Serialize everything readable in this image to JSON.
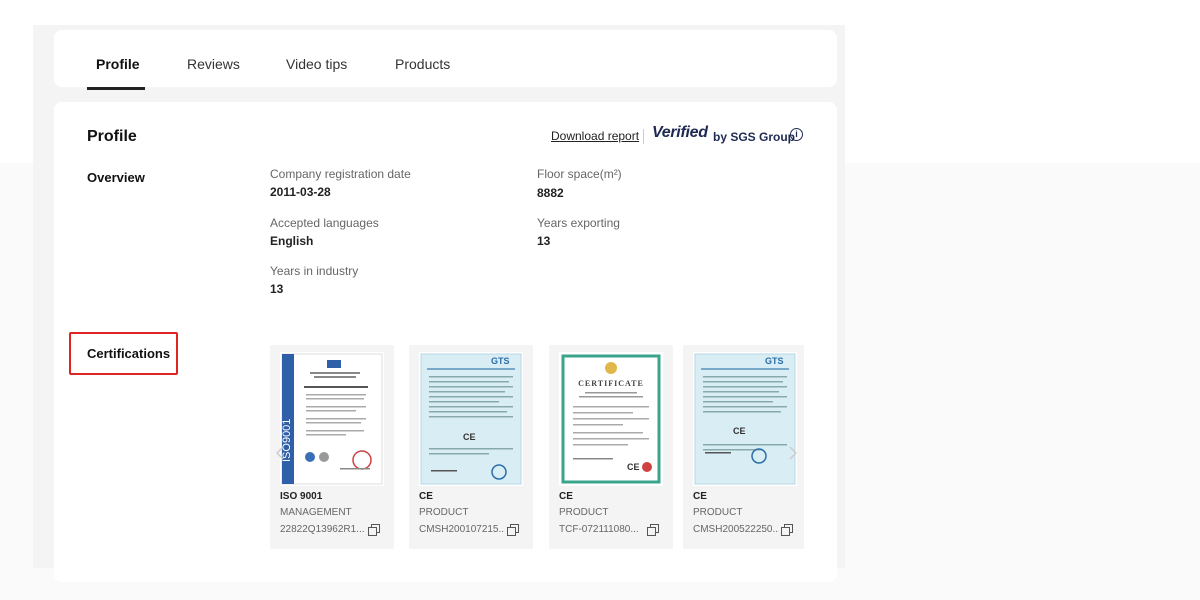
{
  "tabs": [
    {
      "label": "Profile"
    },
    {
      "label": "Reviews"
    },
    {
      "label": "Video tips"
    },
    {
      "label": "Products"
    }
  ],
  "profile": {
    "title": "Profile",
    "download_report": "Download report",
    "verified_word": "Verified",
    "verified_by": "by SGS Group",
    "info_icon": "info-icon"
  },
  "overview": {
    "label": "Overview",
    "fields": [
      {
        "label": "Company registration date",
        "value": "2011-03-28"
      },
      {
        "label": "Floor space(m²)",
        "value": "8882"
      },
      {
        "label": "Accepted languages",
        "value": "English"
      },
      {
        "label": "Years exporting",
        "value": "13"
      },
      {
        "label": "Years in industry",
        "value": "13"
      }
    ]
  },
  "certifications": {
    "label": "Certifications",
    "highlight_color": "#e02424",
    "items": [
      {
        "name": "ISO 9001",
        "type": "MANAGEMENT",
        "id": "22822Q13962R1...",
        "thumb_text": "ISO9001",
        "thumb_style": "iso"
      },
      {
        "name": "CE",
        "type": "PRODUCT",
        "id": "CMSH200107215...",
        "thumb_text": "GTS",
        "thumb_style": "gts"
      },
      {
        "name": "CE",
        "type": "PRODUCT",
        "id": "TCF-072111080...",
        "thumb_text": "CERTIFICATE",
        "thumb_style": "green"
      },
      {
        "name": "CE",
        "type": "PRODUCT",
        "id": "CMSH200522250...",
        "thumb_text": "GTS",
        "thumb_style": "gts"
      }
    ]
  },
  "colors": {
    "brand_navy": "#1f2a52",
    "highlight_red": "#e02424"
  }
}
